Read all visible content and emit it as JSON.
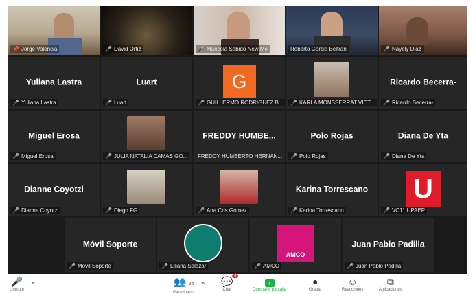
{
  "participants": [
    {
      "bigname": "",
      "label": "Jorge Valencia",
      "icon": "pin-icon"
    },
    {
      "bigname": "",
      "label": "David Ortiz"
    },
    {
      "bigname": "",
      "label": "Maricela Sabido New Me"
    },
    {
      "bigname": "",
      "label": "Roberto Garcia Beltran",
      "active": true
    },
    {
      "bigname": "",
      "label": "Nayely Diaz"
    },
    {
      "bigname": "Yuliana Lastra",
      "label": "Yuliana Lastra"
    },
    {
      "bigname": "Luart",
      "label": "Luart"
    },
    {
      "bigname": "",
      "label": "GUILLERMO RODRIGUEZ B...",
      "avatar_letter": "G"
    },
    {
      "bigname": "",
      "label": "KARLA MONSSERRAT VICT..."
    },
    {
      "bigname": "Ricardo Becerra-",
      "label": "Ricardo Becerra-"
    },
    {
      "bigname": "Miguel Erosa",
      "label": "Miguel Erosa"
    },
    {
      "bigname": "",
      "label": "JULIA NATALIA CAMAS GO..."
    },
    {
      "bigname": "FREDDY HUMBE...",
      "label": "FREDDY HUMBERTO HERNAN..."
    },
    {
      "bigname": "Polo Rojas",
      "label": "Polo Rojas"
    },
    {
      "bigname": "Diana De Yta",
      "label": "Diana De Yta"
    },
    {
      "bigname": "Dianne Coyotzi",
      "label": "Dianne Coyotzi"
    },
    {
      "bigname": "",
      "label": "Diego FG"
    },
    {
      "bigname": "",
      "label": "Ana Cris Gómez"
    },
    {
      "bigname": "Karina Torrescano",
      "label": "Karina Torrescano"
    },
    {
      "bigname": "",
      "label": "VC11 UPAEP",
      "logo_letter": "U"
    },
    {
      "bigname": "Móvil Soporte",
      "label": "Móvil Soporte"
    },
    {
      "bigname": "",
      "label": "Liliana Salazar"
    },
    {
      "bigname": "",
      "label": "AMCO",
      "logo_text": "AMCO"
    },
    {
      "bigname": "Juan Pablo Padilla",
      "label": "Juan Pablo Padilla"
    }
  ],
  "toolbar": {
    "unmute_label": "Unmute",
    "participants_count": "24",
    "participants_label": "Participants",
    "chat_badge": "4",
    "chat_label": "Chat",
    "share_label": "Compartir pantalla",
    "record_label": "Grabar",
    "reactions_label": "Reacciones",
    "apps_label": "Aplicaciones"
  },
  "colors": {
    "active_speaker": "#8bdc3c",
    "muted_icon": "#e23b3b",
    "share_green": "#1fb141"
  }
}
